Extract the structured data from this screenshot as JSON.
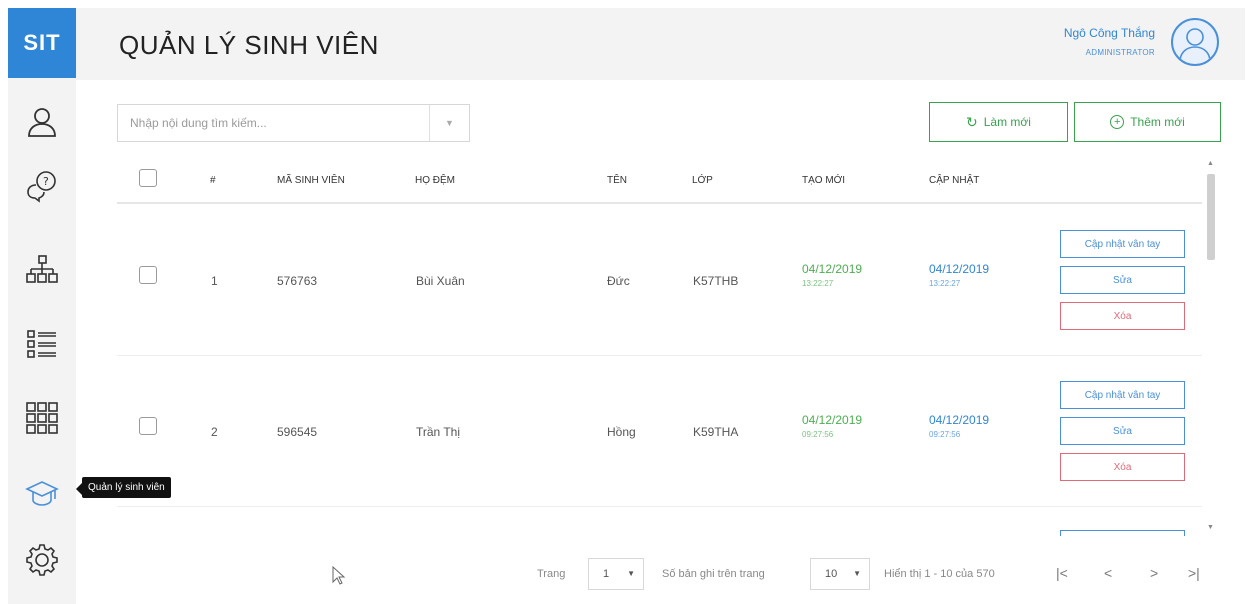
{
  "app": {
    "logo": "SIT",
    "page_title": "QUẢN LÝ SINH VIÊN",
    "tooltip": "Quản lý sinh viên"
  },
  "user": {
    "name": "Ngô Công Thắng",
    "role": "ADMINISTRATOR"
  },
  "sidebar": {
    "items": [
      {
        "icon": "user-icon"
      },
      {
        "icon": "question-chat-icon"
      },
      {
        "icon": "org-chart-icon"
      },
      {
        "icon": "list-icon"
      },
      {
        "icon": "grid-icon"
      },
      {
        "icon": "graduation-cap-icon"
      },
      {
        "icon": "gear-icon"
      }
    ]
  },
  "search": {
    "placeholder": "Nhập nội dung tìm kiếm..."
  },
  "toolbar": {
    "refresh_label": "Làm mới",
    "add_label": "Thêm mới"
  },
  "table": {
    "headers": [
      "#",
      "MÃ SINH VIÊN",
      "HỌ ĐỆM",
      "TÊN",
      "LỚP",
      "TẠO MỚI",
      "CẬP NHẬT"
    ],
    "rows": [
      {
        "index": "1",
        "student_id": "576763",
        "surname": "Bùi Xuân",
        "name": "Đức",
        "class": "K57THB",
        "created_date": "04/12/2019",
        "created_time": "13:22:27",
        "updated_date": "04/12/2019",
        "updated_time": "13:22:27"
      },
      {
        "index": "2",
        "student_id": "596545",
        "surname": "Trần Thị",
        "name": "Hồng",
        "class": "K59THA",
        "created_date": "04/12/2019",
        "created_time": "09:27:56",
        "updated_date": "04/12/2019",
        "updated_time": "09:27:56"
      }
    ],
    "actions": {
      "fingerprint": "Cập nhật vân tay",
      "edit": "Sửa",
      "delete": "Xóa"
    }
  },
  "pagination": {
    "page_label": "Trang",
    "page_value": "1",
    "per_page_label": "Số bản ghi trên trang",
    "per_page_value": "10",
    "summary": "Hiển thị 1 - 10 của 570",
    "first": "|<",
    "prev": "<",
    "next": ">",
    "last": ">|"
  },
  "colors": {
    "brand": "#2f86d6",
    "success": "#39a24e",
    "danger": "#e06a7a",
    "sidebar_bg": "#f3f3f3"
  }
}
